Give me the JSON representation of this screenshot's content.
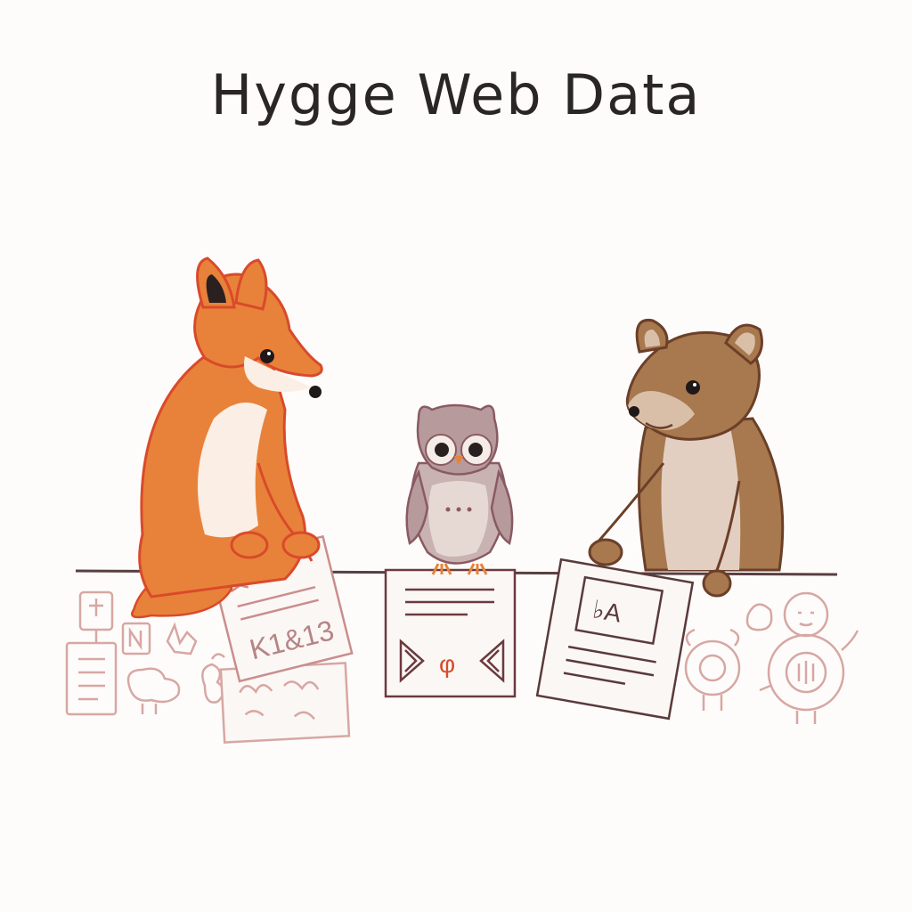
{
  "title": "Hygge Web Data",
  "colors": {
    "fox": "#e8823a",
    "fox_outline": "#d94a2a",
    "owl": "#b79a9c",
    "owl_outline": "#8a5a62",
    "bear": "#a8784e",
    "bear_outline": "#6b3f28",
    "paper_line": "#6b3a3e",
    "sketch_faint": "#d7a7a3",
    "background": "#fdfcfb"
  },
  "icons": [
    "fox-illustration",
    "owl-illustration",
    "bear-illustration",
    "document-sheets",
    "doodles"
  ]
}
